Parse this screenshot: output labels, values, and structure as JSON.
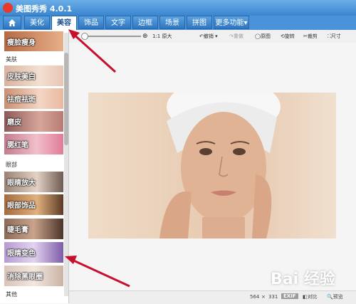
{
  "app": {
    "title": "美图秀秀 4.0.1"
  },
  "tabs": [
    {
      "label": "美化"
    },
    {
      "label": "美容"
    },
    {
      "label": "饰品"
    },
    {
      "label": "文字"
    },
    {
      "label": "边框"
    },
    {
      "label": "场景"
    },
    {
      "label": "拼图"
    },
    {
      "label": "更多功能"
    }
  ],
  "toolbar": {
    "zoom_label": "1:1 原大",
    "rotate": "旋转",
    "crop": "裁剪",
    "original": "原图",
    "undo": "撤销",
    "redo": "重做",
    "size": "尺寸"
  },
  "sidebar": {
    "top_item": "瘦脸瘦身",
    "categories": [
      {
        "name": "美肤",
        "items": [
          "皮肤美白",
          "祛痘祛斑",
          "磨皮",
          "腮红笔"
        ]
      },
      {
        "name": "眼部",
        "items": [
          "眼睛放大",
          "眼部饰品",
          "睫毛膏",
          "眼睛变色",
          "消除黑眼圈"
        ]
      },
      {
        "name": "其他",
        "items": []
      }
    ]
  },
  "status": {
    "width": "564",
    "x": "×",
    "height": "331",
    "exif": "EXIF",
    "compare": "对比",
    "preview": "预览"
  },
  "watermark": "Bai 经验",
  "colors": {
    "accent": "#3a86d0",
    "arrow": "#c8102e"
  }
}
